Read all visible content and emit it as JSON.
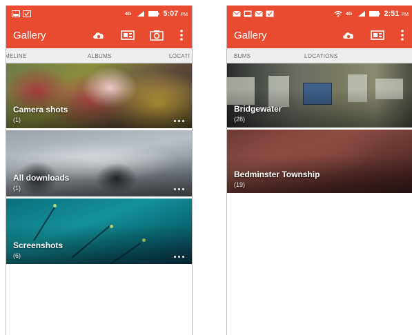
{
  "colors": {
    "accent": "#e84b2f",
    "tab_bar": "#eeeeee"
  },
  "left_phone": {
    "status_bar": {
      "icons": [
        "gallery-icon",
        "checkbox-icon"
      ],
      "right_icons": [
        "4g-icon",
        "signal-icon",
        "battery-icon"
      ],
      "time": "5:07",
      "ampm": "PM"
    },
    "app_bar": {
      "title": "Gallery",
      "actions": [
        "cloud-icon",
        "slideshow-icon",
        "camera-icon",
        "overflow-menu-icon"
      ]
    },
    "tabs": [
      "MELINE",
      "ALBUMS",
      "LOCATI"
    ],
    "albums": [
      {
        "title": "Camera shots",
        "count": "(1)"
      },
      {
        "title": "All downloads",
        "count": "(1)"
      },
      {
        "title": "Screenshots",
        "count": "(6)"
      }
    ]
  },
  "right_phone": {
    "status_bar": {
      "icons": [
        "mail-icon",
        "image-icon",
        "mail-icon",
        "calendar-check-icon"
      ],
      "right_icons": [
        "wifi-icon",
        "4g-icon",
        "signal-icon",
        "battery-icon"
      ],
      "time": "2:51",
      "ampm": "PM"
    },
    "app_bar": {
      "title": "Gallery",
      "actions": [
        "cloud-icon",
        "slideshow-icon",
        "overflow-menu-icon"
      ]
    },
    "tabs": [
      "BUMS",
      "LOCATIONS"
    ],
    "albums": [
      {
        "title": "Bridgewater",
        "count": "(28)"
      },
      {
        "title": "Bedminster Township",
        "count": "(19)"
      }
    ]
  }
}
